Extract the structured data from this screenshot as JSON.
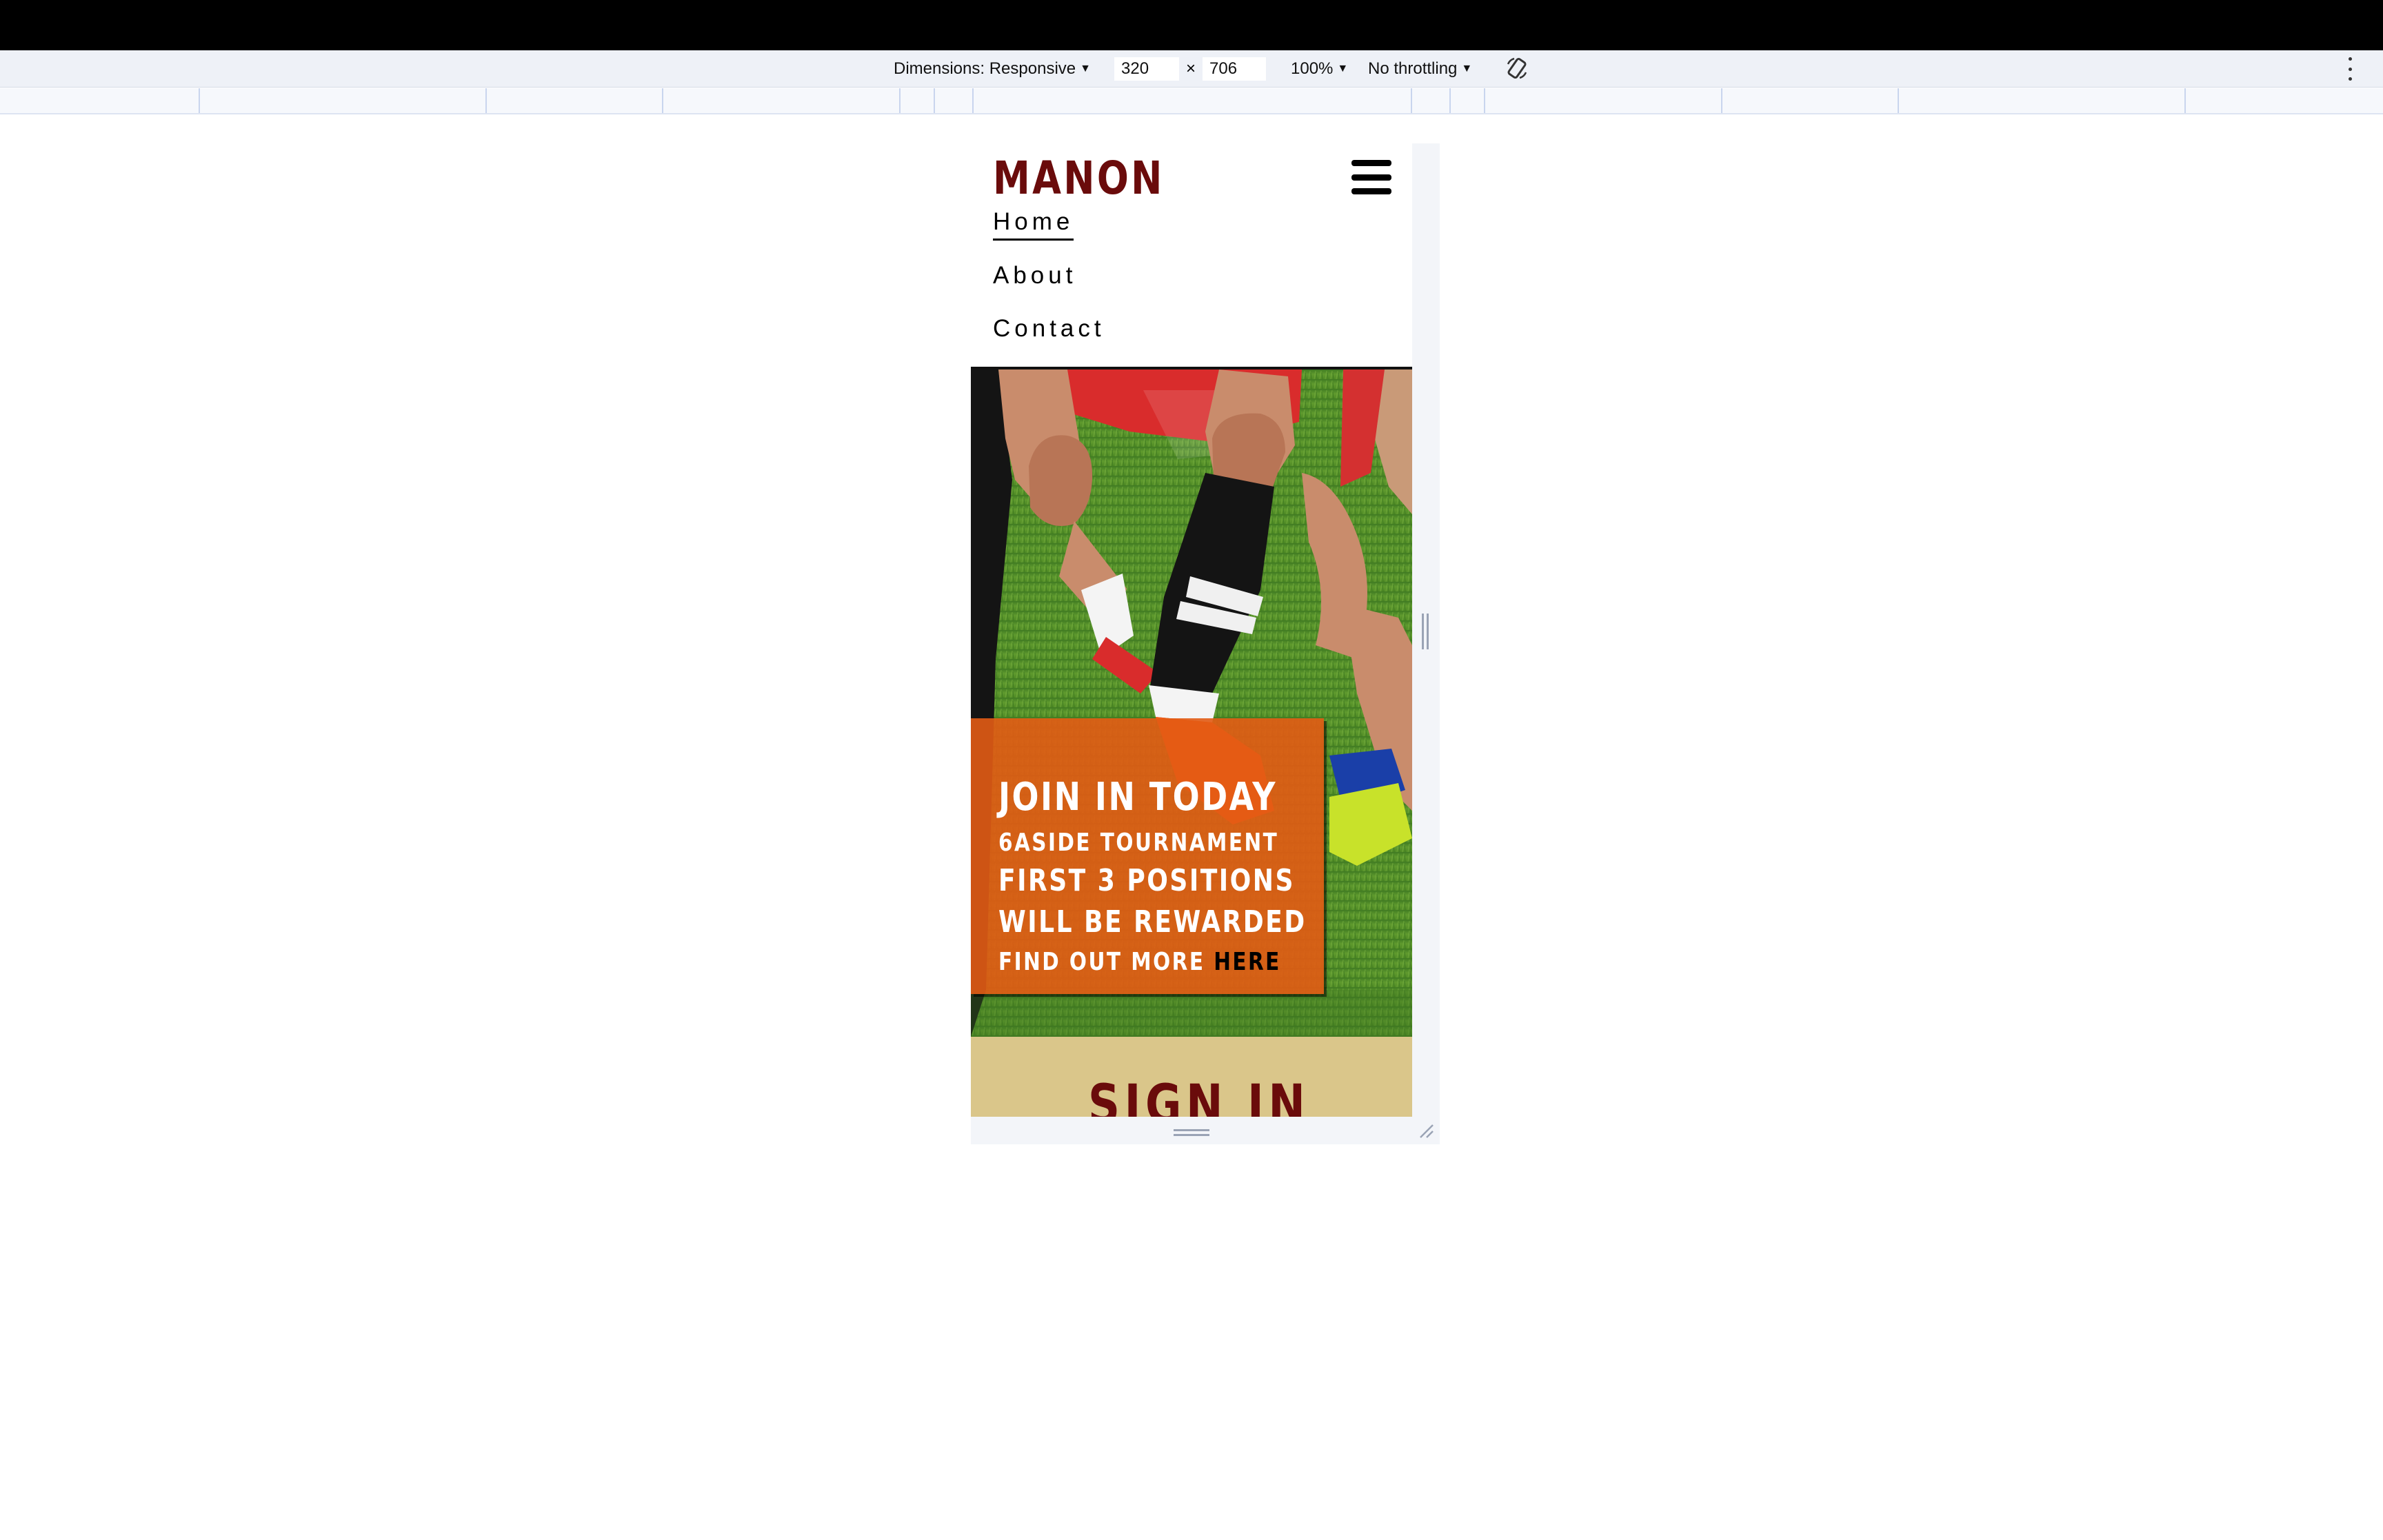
{
  "devtools": {
    "dimensions_label": "Dimensions: Responsive",
    "width_value": "320",
    "times": "×",
    "height_value": "706",
    "zoom_label": "100%",
    "throttle_label": "No throttling",
    "icons": [
      "dropdown-caret-icon",
      "rotate-icon",
      "more-vertical-icon",
      "resize-handle-icon"
    ]
  },
  "site": {
    "logo": "MANON",
    "nav": {
      "home": "Home",
      "about": "About",
      "contact": "Contact"
    },
    "promo": {
      "line1": "JOIN IN TODAY",
      "line2": "6ASIDE TOURNAMENT",
      "line3": "FIRST 3 POSITIONS",
      "line4": "WILL BE REWARDED",
      "line5_prefix": "FIND OUT MORE ",
      "line5_link": "HERE"
    },
    "signin_title": "SIGN IN",
    "colors": {
      "brand": "#6a0b0b",
      "promo_orange": "#e25b14",
      "signin_bg": "#dac68a"
    }
  }
}
